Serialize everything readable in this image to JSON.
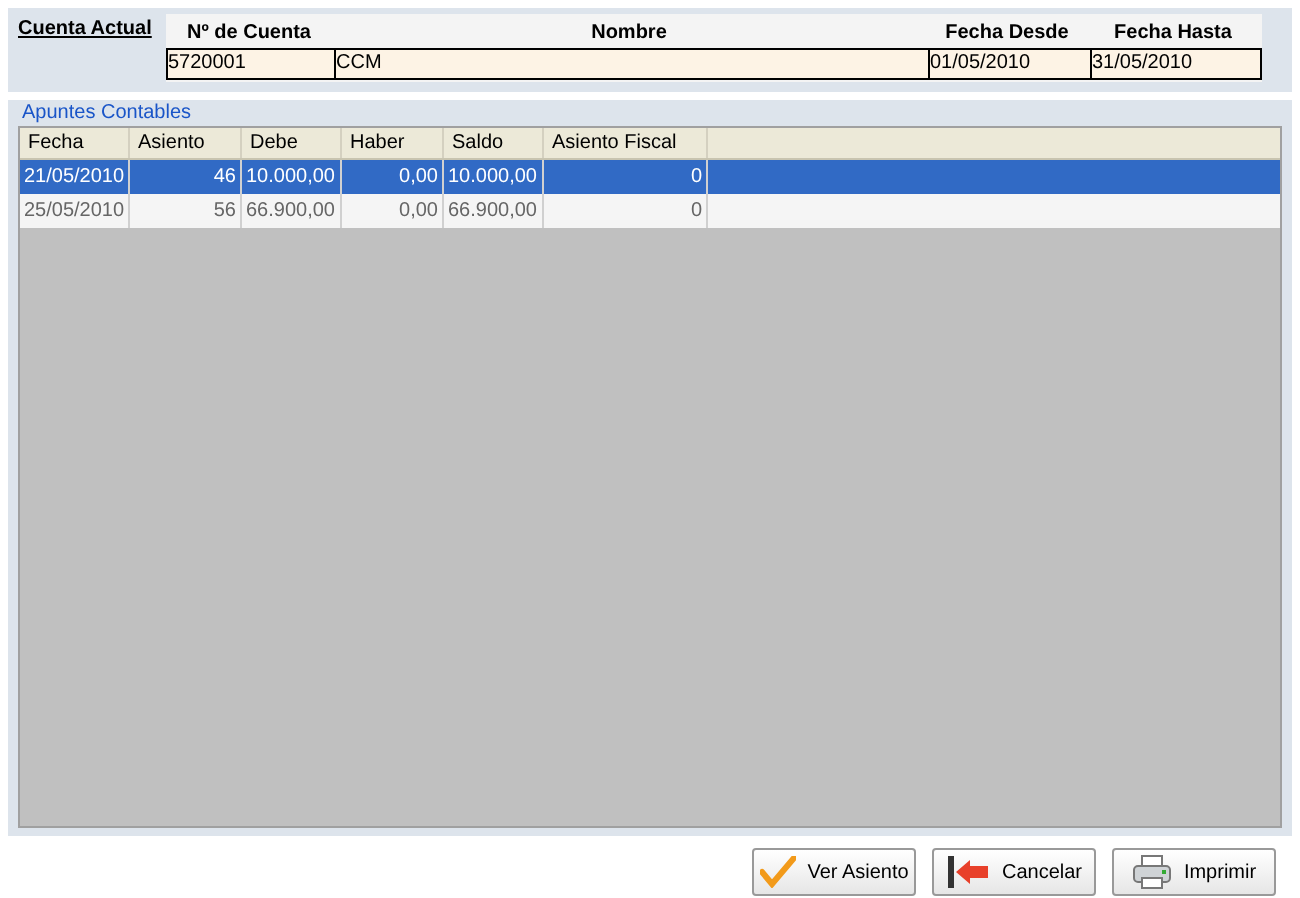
{
  "cuenta_actual": {
    "title": "Cuenta Actual",
    "fields": [
      {
        "label": "Nº de Cuenta",
        "value": "5720001"
      },
      {
        "label": "Nombre",
        "value": "CCM"
      },
      {
        "label": "Fecha Desde",
        "value": "01/05/2010"
      },
      {
        "label": "Fecha Hasta",
        "value": "31/05/2010"
      }
    ]
  },
  "apuntes": {
    "title": "Apuntes Contables",
    "columns": [
      "Fecha",
      "Asiento",
      "Debe",
      "Haber",
      "Saldo",
      "Asiento Fiscal"
    ],
    "rows": [
      {
        "cells": [
          "21/05/2010",
          "46",
          "10.000,00",
          "0,00",
          "10.000,00",
          "0"
        ],
        "selected": true
      },
      {
        "cells": [
          "25/05/2010",
          "56",
          "66.900,00",
          "0,00",
          "66.900,00",
          "0"
        ],
        "selected": false
      }
    ]
  },
  "buttons": [
    {
      "kind": "check",
      "label": "Ver Asiento"
    },
    {
      "kind": "cancel",
      "label": "Cancelar"
    },
    {
      "kind": "print",
      "label": "Imprimir"
    }
  ]
}
